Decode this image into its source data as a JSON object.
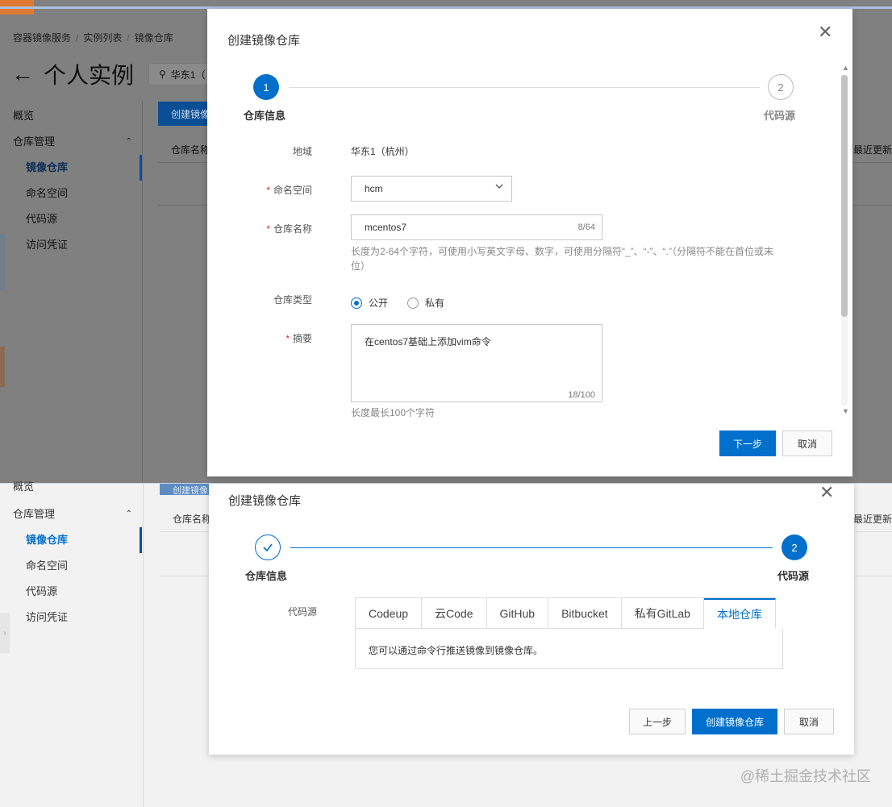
{
  "background": {
    "breadcrumb": [
      "容器镜像服务",
      "实例列表",
      "镜像仓库"
    ],
    "page_title": "个人实例",
    "region": "华东1（",
    "sidebar": {
      "overview": "概览",
      "repo_mgmt": "仓库管理",
      "items": [
        "镜像仓库",
        "命名空间",
        "代码源",
        "访问凭证"
      ]
    },
    "create_btn": "创建镜像",
    "col_repo_name": "仓库名称",
    "col_last_update": "最近更新"
  },
  "modal1": {
    "title": "创建镜像仓库",
    "steps": [
      {
        "number": "1",
        "label": "仓库信息"
      },
      {
        "number": "2",
        "label": "代码源"
      }
    ],
    "fields": {
      "region_label": "地域",
      "region_value": "华东1（杭州）",
      "namespace_label": "命名空间",
      "namespace_value": "hcm",
      "repo_name_label": "仓库名称",
      "repo_name_value": "mcentos7",
      "repo_name_counter": "8/64",
      "repo_name_hint": "长度为2-64个字符，可使用小写英文字母、数字，可使用分隔符“_”、“-”、“.”（分隔符不能在首位或末位）",
      "repo_type_label": "仓库类型",
      "repo_type_public": "公开",
      "repo_type_private": "私有",
      "summary_label": "摘要",
      "summary_value": "在centos7基础上添加vim命令",
      "summary_counter": "18/100",
      "summary_hint": "长度最长100个字符"
    },
    "next_btn": "下一步",
    "cancel_btn": "取消"
  },
  "modal2": {
    "title": "创建镜像仓库",
    "steps": [
      {
        "number": "✓",
        "label": "仓库信息"
      },
      {
        "number": "2",
        "label": "代码源"
      }
    ],
    "source_label": "代码源",
    "tabs": [
      "Codeup",
      "云Code",
      "GitHub",
      "Bitbucket",
      "私有GitLab",
      "本地仓库"
    ],
    "active_tab": "本地仓库",
    "tab_content": "您可以通过命令行推送镜像到镜像仓库。",
    "prev_btn": "上一步",
    "create_btn": "创建镜像仓库",
    "cancel_btn": "取消"
  },
  "bottom_bg": {
    "overview": "概览",
    "repo_mgmt": "仓库管理",
    "items": [
      "镜像仓库",
      "命名空间",
      "代码源",
      "访问凭证"
    ],
    "create_btn": "创建镜像",
    "col_repo_name": "仓库名称",
    "col_last_update": "最近更新"
  },
  "watermark": "@稀土掘金技术社区",
  "colors": {
    "primary": "#0070cc",
    "required": "#d93026"
  }
}
